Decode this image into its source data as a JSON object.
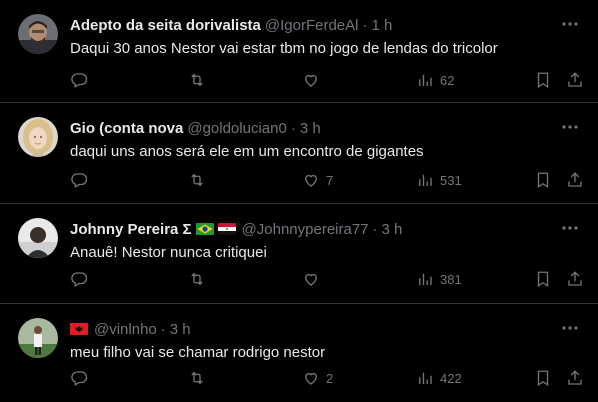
{
  "colors": {
    "background": "#000000",
    "text": "#e7e9ea",
    "secondary": "#71767b",
    "divider": "#2f3336"
  },
  "replies": [
    {
      "name": "Adepto da seita dorivalista",
      "handle": "@IgorFerdeAl",
      "time": "1 h",
      "text": "Daqui 30 anos Nestor vai estar tbm no jogo de lendas do tricolor",
      "stats": {
        "replies": "",
        "reposts": "",
        "likes": "",
        "views": "62"
      }
    },
    {
      "name": "Gio (conta nova",
      "handle": "@goldolucian0",
      "time": "3 h",
      "text": "daqui uns anos será ele em um encontro de gigantes",
      "stats": {
        "replies": "",
        "reposts": "",
        "likes": "7",
        "views": "531"
      }
    },
    {
      "name": "Johnny Pereira Σ",
      "flags": [
        "brazil-flag",
        "egypt-flag"
      ],
      "handle": "@Johnnypereira77",
      "time": "3 h",
      "text": "Anauê! Nestor nunca critiquei",
      "stats": {
        "replies": "",
        "reposts": "",
        "likes": "",
        "views": "381"
      }
    },
    {
      "name": "",
      "flags": [
        "albania-flag"
      ],
      "handle": "@vinlnho",
      "time": "3 h",
      "text": "meu filho vai se chamar rodrigo nestor",
      "stats": {
        "replies": "",
        "reposts": "",
        "likes": "2",
        "views": "422"
      }
    }
  ],
  "separator": "·",
  "icons": [
    "more-icon",
    "reply-icon",
    "repost-icon",
    "like-icon",
    "views-icon",
    "bookmark-icon",
    "share-icon"
  ]
}
